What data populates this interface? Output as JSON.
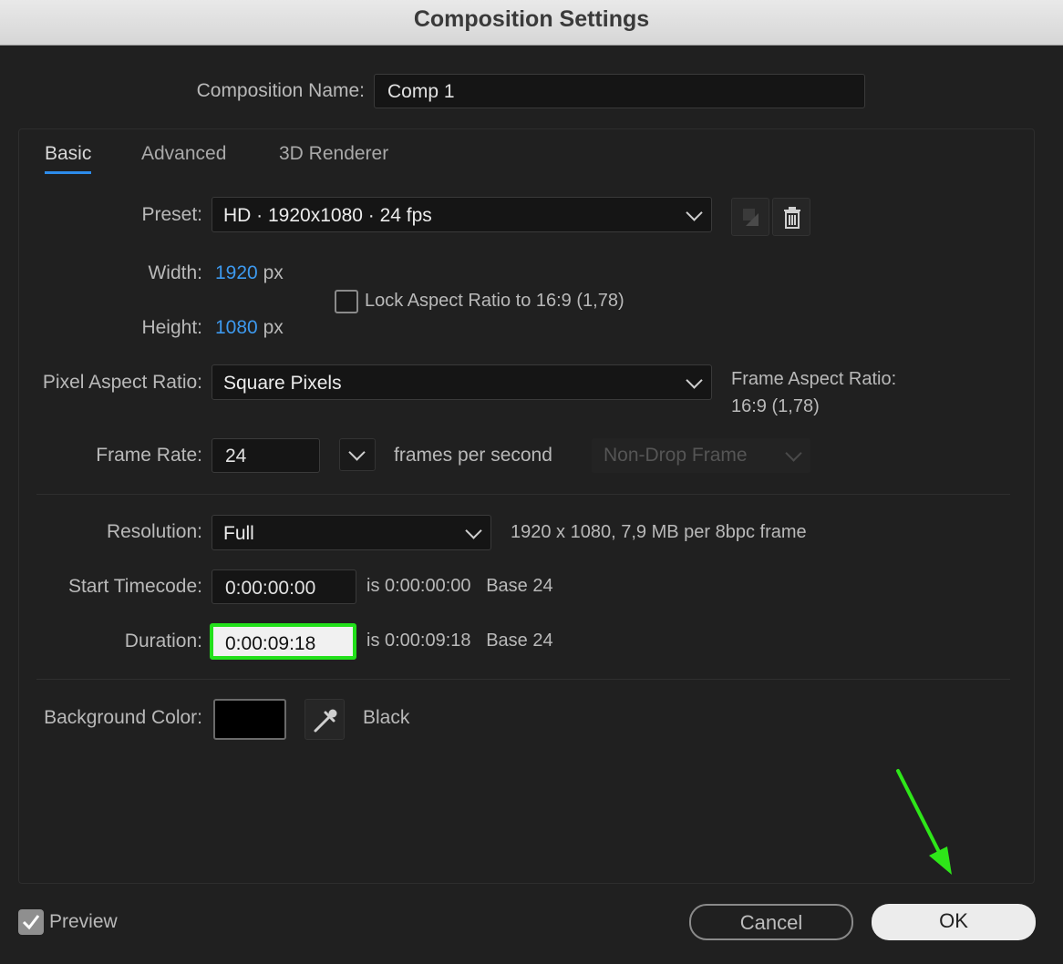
{
  "dialog": {
    "title": "Composition Settings"
  },
  "composition_name": {
    "label": "Composition Name:",
    "value": "Comp 1"
  },
  "tabs": [
    {
      "label": "Basic",
      "active": true
    },
    {
      "label": "Advanced",
      "active": false
    },
    {
      "label": "3D Renderer",
      "active": false
    }
  ],
  "preset": {
    "label": "Preset:",
    "value": "HD  ·  1920x1080 · 24 fps"
  },
  "width": {
    "label": "Width:",
    "value": "1920",
    "unit": "px"
  },
  "height": {
    "label": "Height:",
    "value": "1080",
    "unit": "px"
  },
  "lock_aspect": {
    "label": "Lock Aspect Ratio to 16:9 (1,78)",
    "checked": false
  },
  "pixel_aspect": {
    "label": "Pixel Aspect Ratio:",
    "value": "Square Pixels"
  },
  "frame_aspect": {
    "label": "Frame Aspect Ratio:",
    "value": "16:9 (1,78)"
  },
  "frame_rate": {
    "label": "Frame Rate:",
    "value": "24",
    "unit": "frames per second",
    "drop_frame": "Non-Drop Frame"
  },
  "resolution": {
    "label": "Resolution:",
    "value": "Full",
    "info": "1920 x 1080, 7,9 MB per 8bpc frame"
  },
  "start_timecode": {
    "label": "Start Timecode:",
    "value": "0:00:00:00",
    "info": "is 0:00:00:00",
    "base": "Base 24"
  },
  "duration": {
    "label": "Duration:",
    "value": "0:00:09:18",
    "info": "is 0:00:09:18",
    "base": "Base 24"
  },
  "background": {
    "label": "Background Color:",
    "color": "#000000",
    "name": "Black"
  },
  "preview": {
    "label": "Preview",
    "checked": true
  },
  "buttons": {
    "cancel": "Cancel",
    "ok": "OK"
  },
  "colors": {
    "accent": "#2d8ceb",
    "highlight": "#22e01a",
    "annotation_arrow": "#2ee619"
  }
}
